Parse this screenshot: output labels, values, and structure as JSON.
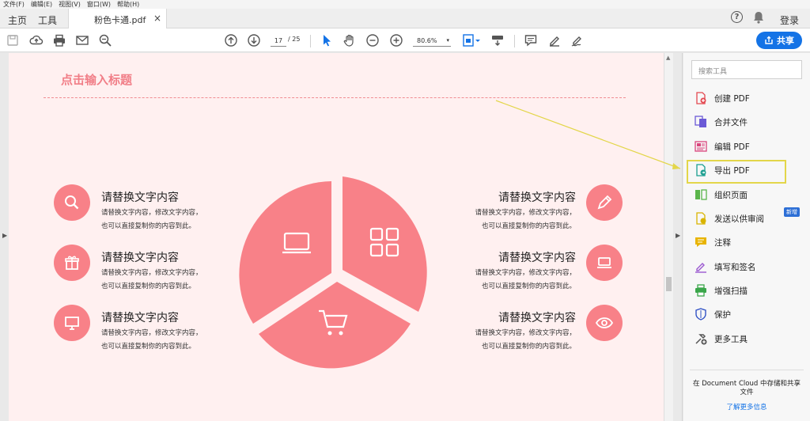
{
  "menu": {
    "file": "文件(F)",
    "edit": "编辑(E)",
    "view": "视图(V)",
    "window": "窗口(W)",
    "help": "帮助(H)"
  },
  "tabs": {
    "home": "主页",
    "tools": "工具",
    "document": "粉色卡通.pdf",
    "close": "×"
  },
  "header": {
    "help": "?",
    "login": "登录"
  },
  "toolbar": {
    "page_current": "17",
    "page_total": "/ 25",
    "zoom": "80.6%",
    "share": "共享"
  },
  "page": {
    "title": "点击输入标题",
    "left_items": [
      {
        "heading": "请替换文字内容",
        "line1": "请替换文字内容，修改文字内容，",
        "line2": "也可以直接复制你的内容到此。",
        "icon": "search-icon"
      },
      {
        "heading": "请替换文字内容",
        "line1": "请替换文字内容，修改文字内容，",
        "line2": "也可以直接复制你的内容到此。",
        "icon": "gift-icon"
      },
      {
        "heading": "请替换文字内容",
        "line1": "请替换文字内容，修改文字内容，",
        "line2": "也可以直接复制你的内容到此。",
        "icon": "monitor-icon"
      }
    ],
    "right_items": [
      {
        "heading": "请替换文字内容",
        "line1": "请替换文字内容，修改文字内容，",
        "line2": "也可以直接复制你的内容到此。",
        "icon": "pencil-icon"
      },
      {
        "heading": "请替换文字内容",
        "line1": "请替换文字内容，修改文字内容，",
        "line2": "也可以直接复制你的内容到此。",
        "icon": "laptop-icon"
      },
      {
        "heading": "请替换文字内容",
        "line1": "请替换文字内容，修改文字内容，",
        "line2": "也可以直接复制你的内容到此。",
        "icon": "eye-icon"
      }
    ],
    "pie_icons": [
      "laptop-icon",
      "grid-icon",
      "cart-icon"
    ],
    "accent_color": "#f88188"
  },
  "tools_panel": {
    "search_placeholder": "搜索工具",
    "items": [
      {
        "label": "创建 PDF",
        "icon": "create-pdf-icon"
      },
      {
        "label": "合并文件",
        "icon": "combine-files-icon"
      },
      {
        "label": "编辑 PDF",
        "icon": "edit-pdf-icon"
      },
      {
        "label": "导出 PDF",
        "icon": "export-pdf-icon"
      },
      {
        "label": "组织页面",
        "icon": "organize-pages-icon"
      },
      {
        "label": "发送以供审阅",
        "icon": "send-review-icon"
      },
      {
        "label": "注释",
        "icon": "comment-icon"
      },
      {
        "label": "填写和签名",
        "icon": "fill-sign-icon"
      },
      {
        "label": "增强扫描",
        "icon": "enhance-scan-icon"
      },
      {
        "label": "保护",
        "icon": "protect-icon"
      },
      {
        "label": "更多工具",
        "icon": "more-tools-icon"
      }
    ],
    "new_badge": "新增",
    "cloud_text": "在 Document Cloud 中存储和共享文件",
    "learn_more": "了解更多信息"
  }
}
